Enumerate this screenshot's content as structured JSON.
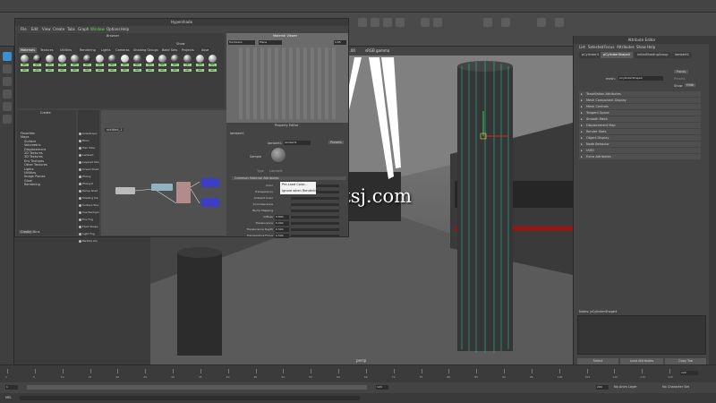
{
  "app": {
    "title": "Hypershade"
  },
  "main_menu": [
    "File",
    "Edit",
    "Create",
    "Select",
    "Modify",
    "Display",
    "Windows",
    "Mesh",
    "Edit Mesh",
    "Mesh Tools",
    "Mesh Display",
    "Curves",
    "Surfaces",
    "Deform",
    "UV",
    "Generate",
    "Cache",
    "Help"
  ],
  "hypershade": {
    "title": "Hypershade",
    "menu": [
      "File",
      "Edit",
      "View",
      "Create",
      "Tabs",
      "Graph",
      "Window",
      "Options",
      "Help"
    ],
    "browser": {
      "title": "Browser",
      "tabs": [
        "Materials",
        "Textures",
        "Utilities",
        "Rendering",
        "Lights",
        "Cameras",
        "Shading Groups",
        "Bake Sets",
        "Projects",
        "Asse"
      ],
      "swatch_labels": [
        "lam",
        "gra",
        "lam",
        "lam",
        "lam",
        "lam",
        "lam",
        "lam",
        "lam",
        "lam",
        "lam",
        "lam",
        "lam",
        "sec",
        "lam",
        "lam"
      ],
      "filter_label": "Show"
    },
    "create": {
      "title": "Create",
      "tree": [
        "Favorites",
        "Maya",
        "Surface",
        "Volumetric",
        "Displacement",
        "2D Textures",
        "3D Textures",
        "Env Textures",
        "Other Textures",
        "Lights",
        "Utilities",
        "Image Planes",
        "Glow",
        "Rendering"
      ],
      "nodes": [
        "Anisotropic",
        "Blinn",
        "Hair Tube",
        "Lambert",
        "Layered She",
        "Ocean Shad",
        "Phong",
        "Phong E",
        "Ramp Shad",
        "Shading Ma",
        "Surface Sha",
        "Use Backgro",
        "Env Fog",
        "Fluid Shape",
        "Light Fog",
        "Particle Clo"
      ],
      "tabs": [
        "Create",
        "Bins"
      ]
    },
    "graph": {
      "tab": "untitled_1"
    },
    "material_viewer": {
      "title": "Material Viewer",
      "renderer": "Hardware",
      "shape": "Plane",
      "value": "0.65"
    },
    "property_editor": {
      "title": "Property Editor",
      "node_name": "lambert1",
      "presets_label": "Presets",
      "lambert_label": "lambert1",
      "sample_label": "Sample",
      "type_label": "Type",
      "type_value": "Lambert",
      "section": "Common Material Attributes",
      "attrs": [
        "Color",
        "Transparency",
        "Ambient Color",
        "Incandescence",
        "Bump Mapping",
        "Diffuse",
        "Translucence",
        "Translucence Depth",
        "Translucence Focus"
      ],
      "values": [
        "",
        "",
        "",
        "",
        "",
        "0.800",
        "0.000",
        "0.500",
        "0.500"
      ],
      "context_menu": [
        "Pre-Load Color...",
        "Ignore when Rendering"
      ]
    }
  },
  "viewport": {
    "readouts": {
      "gamma": "sRGB gamma",
      "val1": "0.00",
      "val2": "1.00"
    },
    "camera_label": "persp"
  },
  "watermark": "www.cgtsj.com",
  "attribute_editor": {
    "title": "Attribute Editor",
    "menu": [
      "List",
      "Selected",
      "Focus",
      "Attributes",
      "Show",
      "Help"
    ],
    "tabs": [
      "pCylinder4",
      "pCylinderShape4",
      "initialShadingGroup",
      "lambert1"
    ],
    "mesh_label": "mesh:",
    "mesh_value": "pCylinderShape4",
    "focus_btn": "Focus",
    "presets_btn": "Presets",
    "show_btn": "Show",
    "hide_btn": "Hide",
    "sections": [
      "Tessellation Attributes",
      "Mesh Component Display",
      "Mesh Controls",
      "Tangent Space",
      "Smooth Mesh",
      "Displacement Map",
      "Render Stats",
      "Object Display",
      "Node Behavior",
      "UUID",
      "Extra Attributes"
    ],
    "notes_label": "Notes:  pCylinderShape4",
    "buttons": [
      "Select",
      "Load Attributes",
      "Copy Tab"
    ]
  },
  "timeline": {
    "ticks": [
      "1",
      "5",
      "10",
      "15",
      "20",
      "25",
      "30",
      "35",
      "40",
      "45",
      "50",
      "55",
      "60",
      "65",
      "70",
      "75",
      "80",
      "85",
      "90",
      "95",
      "100",
      "105",
      "110",
      "115",
      "120"
    ],
    "range_start": "1",
    "range_end": "120",
    "anim_end": "200",
    "current": "120",
    "no_anim_layer": "No Anim Layer",
    "no_char_set": "No Character Set"
  },
  "cmdline": {
    "label": "MEL"
  },
  "colors": {
    "accent": "#3c8fd0",
    "selected_wire": "#28c0a0",
    "material_label": "#9bd58c"
  }
}
